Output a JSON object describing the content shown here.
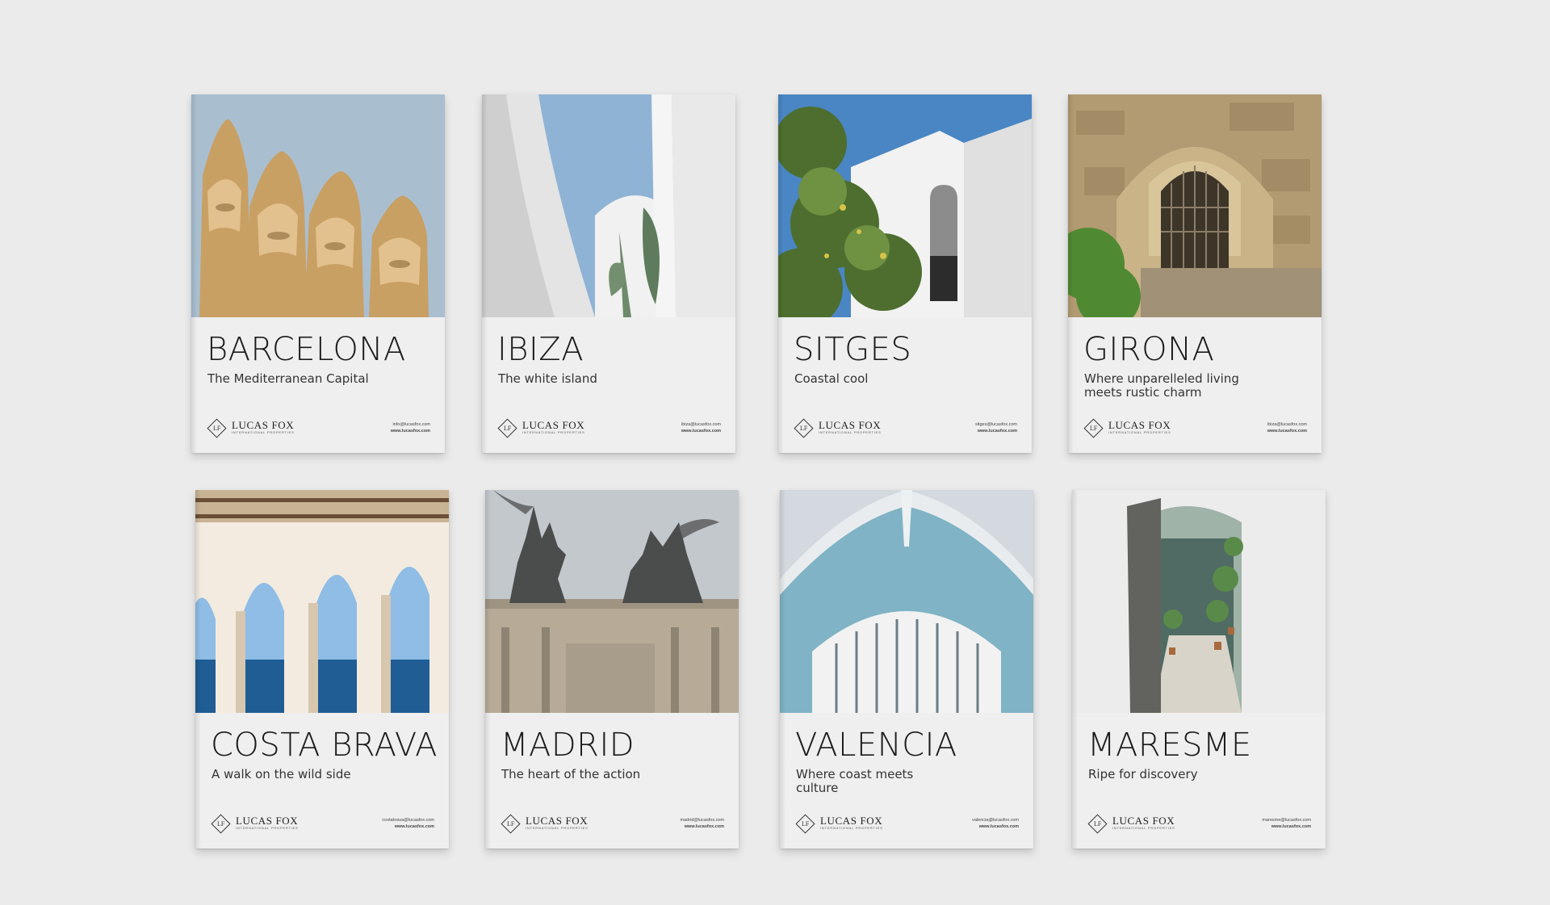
{
  "brand": {
    "name": "LUCAS FOX",
    "tagline": "INTERNATIONAL PROPERTIES",
    "mark": "LF"
  },
  "booklets": [
    {
      "title": "BARCELONA",
      "subtitle": "The Mediterranean Capital",
      "email": "info@lucasfox.com",
      "website": "www.lucasfox.com"
    },
    {
      "title": "IBIZA",
      "subtitle": "The white island",
      "email": "ibiza@lucasfox.com",
      "website": "www.lucasfox.com"
    },
    {
      "title": "SITGES",
      "subtitle": "Coastal cool",
      "email": "sitges@lucasfox.com",
      "website": "www.lucasfox.com"
    },
    {
      "title": "GIRONA",
      "subtitle": "Where unparelleled living meets rustic charm",
      "email": "ibiza@lucasfox.com",
      "website": "www.lucasfox.com"
    },
    {
      "title": "COSTA BRAVA",
      "subtitle": "A walk on the wild side",
      "email": "costabrava@lucasfox.com",
      "website": "www.lucasfox.com"
    },
    {
      "title": "MADRID",
      "subtitle": "The heart of the action",
      "email": "madrid@lucasfox.com",
      "website": "www.lucasfox.com"
    },
    {
      "title": "VALENCIA",
      "subtitle": "Where coast meets culture",
      "email": "valencia@lucasfox.com",
      "website": "www.lucasfox.com"
    },
    {
      "title": "MARESME",
      "subtitle": "Ripe for discovery",
      "email": "maresme@lucasfox.com",
      "website": "www.lucasfox.com"
    }
  ]
}
